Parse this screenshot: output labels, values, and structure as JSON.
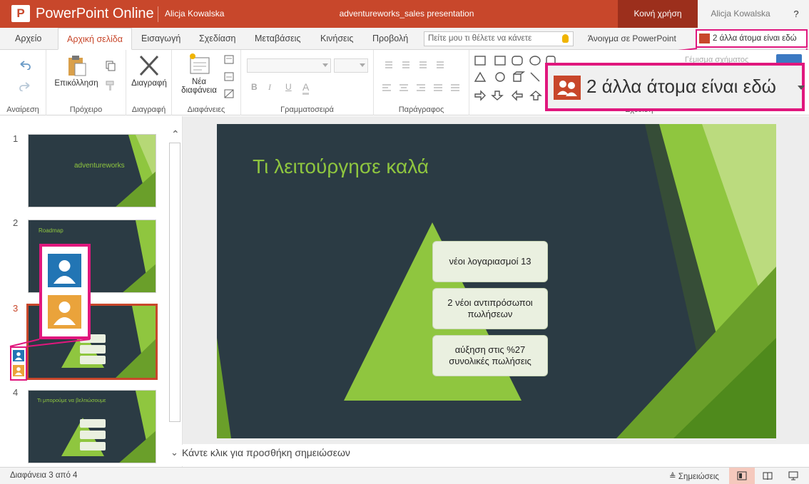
{
  "titlebar": {
    "app_name": "PowerPoint Online",
    "owner": "Alicja Kowalska",
    "document_name": "adventureworks_sales presentation",
    "share_label": "Κοινή χρήση",
    "user_name": "Alicja Kowalska",
    "help_label": "?"
  },
  "tabs": [
    {
      "label": "Αρχείο"
    },
    {
      "label": "Αρχική σελίδα",
      "active": true
    },
    {
      "label": "Εισαγωγή"
    },
    {
      "label": "Σχεδίαση"
    },
    {
      "label": "Μεταβάσεις"
    },
    {
      "label": "Κινήσεις"
    },
    {
      "label": "Προβολή"
    }
  ],
  "tellme": {
    "placeholder": "Πείτε μου τι θέλετε να κάνετε"
  },
  "open_in_ppt": "Άνοιγμα σε PowerPoint",
  "presence": {
    "label": "2 άλλα άτομα είναι εδώ"
  },
  "ribbon": {
    "groups": {
      "undo": "Αναίρεση",
      "clipboard": "Πρόχειρο",
      "delete": "Διαγραφή",
      "slides": "Διαφάνειες",
      "font": "Γραμματοσειρά",
      "paragraph": "Παράγραφος",
      "drawing": "Σχέδιση"
    },
    "paste_label": "Επικόλληση",
    "delete_label": "Διαγραφή",
    "new_slide_label_1": "Νέα",
    "new_slide_label_2": "διαφάνεια",
    "shape_fill_label": "Γέμισμα σχήματος",
    "font_buttons": [
      "B",
      "I",
      "U",
      "A"
    ]
  },
  "thumbnails": [
    {
      "number": "1",
      "title": "adventureworks"
    },
    {
      "number": "2",
      "title": "Roadmap"
    },
    {
      "number": "3",
      "title": "",
      "selected": true,
      "cards": [
        "νέοι λογαριασμοί 13",
        "2 νέοι αντιπρόσωποι πωλήσεων",
        "αύξηση στις %27 συνολικές πωλήσεις"
      ]
    },
    {
      "number": "4",
      "title": "Τι μπορούμε να βελτιώσουμε",
      "cards": [
        "νέοι λογαριασμοί 13",
        "2 νέοι αντιπρόσωποι πωλήσεων",
        "αύξηση στις %27 συνολικές πωλήσεις"
      ]
    }
  ],
  "slide": {
    "title": "Τι λειτούργησε καλά",
    "cards": [
      {
        "line1": "νέοι λογαριασμοί 13",
        "line2": ""
      },
      {
        "line1": "2 νέοι αντιπρόσωποι",
        "line2": "πωλήσεων"
      },
      {
        "line1": "αύξηση στις  %27",
        "line2": "συνολικές πωλήσεις"
      }
    ]
  },
  "notes": {
    "placeholder": "Κάντε κλικ για προσθήκη σημειώσεων"
  },
  "status": {
    "slide_position": "Διαφάνεια 3 από 4",
    "notes_label": "Σημειώσεις"
  },
  "colors": {
    "brand": "#c8472b",
    "highlight": "#e0177d",
    "slide_bg": "#2b3b44",
    "accent_green": "#8fc63f",
    "avatar_blue": "#2275b4",
    "avatar_orange": "#eaa33b"
  }
}
